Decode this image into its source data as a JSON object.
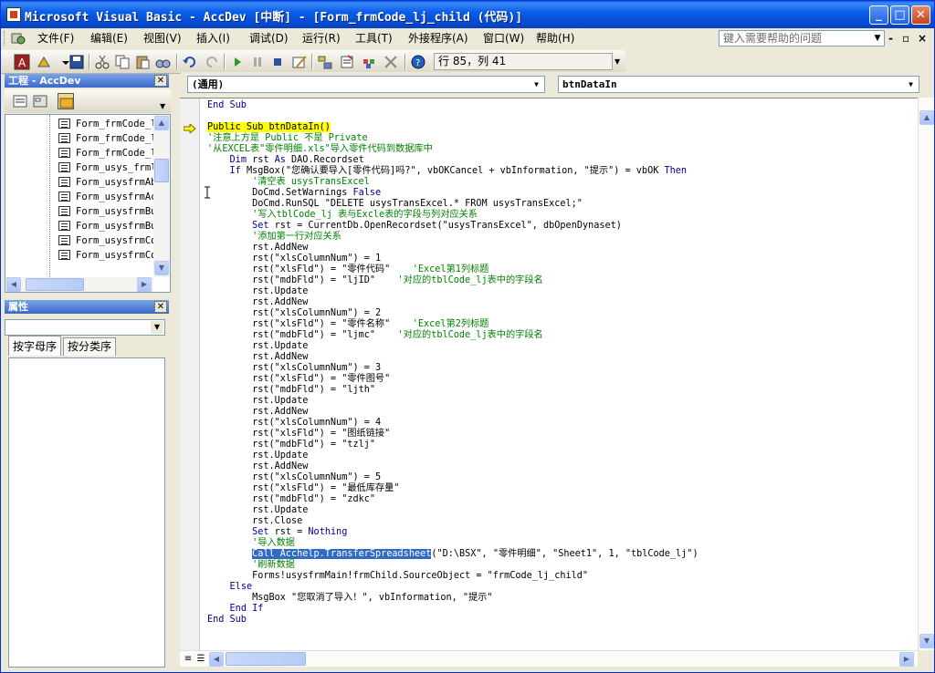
{
  "window": {
    "title": "Microsoft Visual Basic - AccDev [中断] - [Form_frmCode_lj_child (代码)]"
  },
  "menu": {
    "items": [
      "文件(F)",
      "编辑(E)",
      "视图(V)",
      "插入(I)",
      "调试(D)",
      "运行(R)",
      "工具(T)",
      "外接程序(A)",
      "窗口(W)",
      "帮助(H)"
    ],
    "help_placeholder": "键入需要帮助的问题"
  },
  "toolbar": {
    "position": "行 85，列 41"
  },
  "project_panel": {
    "title": "工程 - AccDev",
    "items": [
      "Form_frmCode_l",
      "Form_frmCode_l",
      "Form_frmCode_l",
      "Form_usys_frml",
      "Form_usysfrmAb",
      "Form_usysfrmAc",
      "Form_usysfrmBu",
      "Form_usysfrmBu",
      "Form_usysfrmCo",
      "Form_usysfrmCo"
    ]
  },
  "properties_panel": {
    "title": "属性",
    "tabs": [
      "按字母序",
      "按分类序"
    ]
  },
  "code_window": {
    "object_combo": "(通用)",
    "procedure_combo": "btnDataIn",
    "lines": [
      [
        {
          "t": "End Sub",
          "c": "kw"
        }
      ],
      [
        {
          "t": ""
        }
      ],
      [
        {
          "t": "Public Sub btnDataIn()",
          "c": "hl-yellow"
        }
      ],
      [
        {
          "t": "'注意上方是 Public 不是 Private",
          "c": "cm"
        }
      ],
      [
        {
          "t": "'从EXCEL表\"零件明细.xls\"导入零件代码到数据库中",
          "c": "cm"
        }
      ],
      [
        {
          "t": "    "
        },
        {
          "t": "Dim",
          "c": "kw"
        },
        {
          "t": " rst "
        },
        {
          "t": "As",
          "c": "kw"
        },
        {
          "t": " DAO.Recordset"
        }
      ],
      [
        {
          "t": "    "
        },
        {
          "t": "If",
          "c": "kw"
        },
        {
          "t": " MsgBox(\"您确认要导入[零件代码]吗?\", vbOKCancel + vbInformation, \"提示\") = vbOK "
        },
        {
          "t": "Then",
          "c": "kw"
        }
      ],
      [
        {
          "t": "        "
        },
        {
          "t": "'清空表 usysTransExcel",
          "c": "cm"
        }
      ],
      [
        {
          "t": "        DoCmd.SetWarnings "
        },
        {
          "t": "False",
          "c": "kw"
        }
      ],
      [
        {
          "t": "        DoCmd.RunSQL \"DELETE usysTransExcel.* FROM usysTransExcel;\""
        }
      ],
      [
        {
          "t": "        "
        },
        {
          "t": "'写入tblCode_lj 表与Excle表的字段与列对应关系",
          "c": "cm"
        }
      ],
      [
        {
          "t": "        "
        },
        {
          "t": "Set",
          "c": "kw"
        },
        {
          "t": " rst = CurrentDb.OpenRecordset(\"usysTransExcel\", dbOpenDynaset)"
        }
      ],
      [
        {
          "t": "        "
        },
        {
          "t": "'添加第一行对应关系",
          "c": "cm"
        }
      ],
      [
        {
          "t": "        rst.AddNew"
        }
      ],
      [
        {
          "t": "        rst(\"xlsColumnNum\") = 1"
        }
      ],
      [
        {
          "t": "        rst(\"xlsFld\") = \"零件代码\"    "
        },
        {
          "t": "'Excel第1列标题",
          "c": "cm"
        }
      ],
      [
        {
          "t": "        rst(\"mdbFld\") = \"ljID\"    "
        },
        {
          "t": "'对应的tblCode_lj表中的字段名",
          "c": "cm"
        }
      ],
      [
        {
          "t": "        rst.Update"
        }
      ],
      [
        {
          "t": "        rst.AddNew"
        }
      ],
      [
        {
          "t": "        rst(\"xlsColumnNum\") = 2"
        }
      ],
      [
        {
          "t": "        rst(\"xlsFld\") = \"零件名称\"    "
        },
        {
          "t": "'Excel第2列标题",
          "c": "cm"
        }
      ],
      [
        {
          "t": "        rst(\"mdbFld\") = \"ljmc\"    "
        },
        {
          "t": "'对应的tblCode_lj表中的字段名",
          "c": "cm"
        }
      ],
      [
        {
          "t": "        rst.Update"
        }
      ],
      [
        {
          "t": "        rst.AddNew"
        }
      ],
      [
        {
          "t": "        rst(\"xlsColumnNum\") = 3"
        }
      ],
      [
        {
          "t": "        rst(\"xlsFld\") = \"零件图号\""
        }
      ],
      [
        {
          "t": "        rst(\"mdbFld\") = \"ljth\""
        }
      ],
      [
        {
          "t": "        rst.Update"
        }
      ],
      [
        {
          "t": "        rst.AddNew"
        }
      ],
      [
        {
          "t": "        rst(\"xlsColumnNum\") = 4"
        }
      ],
      [
        {
          "t": "        rst(\"xlsFld\") = \"图纸链接\""
        }
      ],
      [
        {
          "t": "        rst(\"mdbFld\") = \"tzlj\""
        }
      ],
      [
        {
          "t": "        rst.Update"
        }
      ],
      [
        {
          "t": "        rst.AddNew"
        }
      ],
      [
        {
          "t": "        rst(\"xlsColumnNum\") = 5"
        }
      ],
      [
        {
          "t": "        rst(\"xlsFld\") = \"最低库存量\""
        }
      ],
      [
        {
          "t": "        rst(\"mdbFld\") = \"zdkc\""
        }
      ],
      [
        {
          "t": "        rst.Update"
        }
      ],
      [
        {
          "t": "        rst.Close"
        }
      ],
      [
        {
          "t": "        "
        },
        {
          "t": "Set",
          "c": "kw"
        },
        {
          "t": " rst = "
        },
        {
          "t": "Nothing",
          "c": "kw"
        }
      ],
      [
        {
          "t": "        "
        },
        {
          "t": "'导入数据",
          "c": "cm"
        }
      ],
      [
        {
          "t": "        "
        },
        {
          "t": "Call Acchelp.TransferSpreadsheet",
          "c": "hl-sel"
        },
        {
          "t": "(\"D:\\BSX\", \"零件明细\", \"Sheet1\", 1, \"tblCode_lj\")"
        }
      ],
      [
        {
          "t": "        "
        },
        {
          "t": "'刷新数据",
          "c": "cm"
        }
      ],
      [
        {
          "t": "        Forms!usysfrmMain!frmChild.SourceObject = \"frmCode_lj_child\""
        }
      ],
      [
        {
          "t": "    "
        },
        {
          "t": "Else",
          "c": "kw"
        }
      ],
      [
        {
          "t": "        MsgBox \"您取消了导入！\", vbInformation, \"提示\""
        }
      ],
      [
        {
          "t": "    "
        },
        {
          "t": "End If",
          "c": "kw"
        }
      ],
      [
        {
          "t": "End Sub",
          "c": "kw"
        }
      ]
    ]
  },
  "colors": {
    "title_bar": "#0a5ee9",
    "keyword": "#00008b",
    "comment": "#008000",
    "exec_highlight": "#ffff00",
    "selection": "#316ac5"
  }
}
